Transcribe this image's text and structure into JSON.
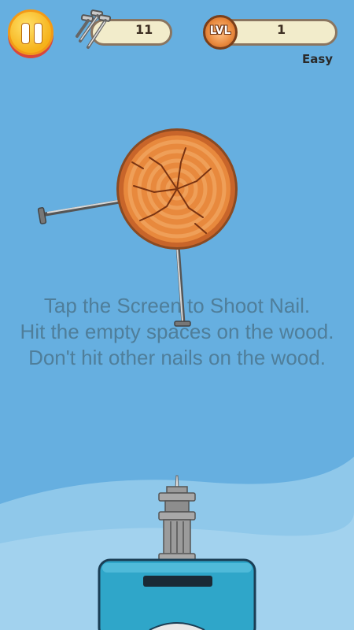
{
  "hud": {
    "nails_count": "11",
    "level_badge": "LVL",
    "level_value": "1",
    "difficulty": "Easy"
  },
  "instructions": {
    "line1": "Tap the Screen to Shoot Nail.",
    "line2": "Hit the empty spaces on the wood.",
    "line3": "Don't hit other nails on the wood."
  },
  "colors": {
    "sky": "#66afe0",
    "wood": "#e8893d",
    "launcher": "#2fa6c9"
  }
}
